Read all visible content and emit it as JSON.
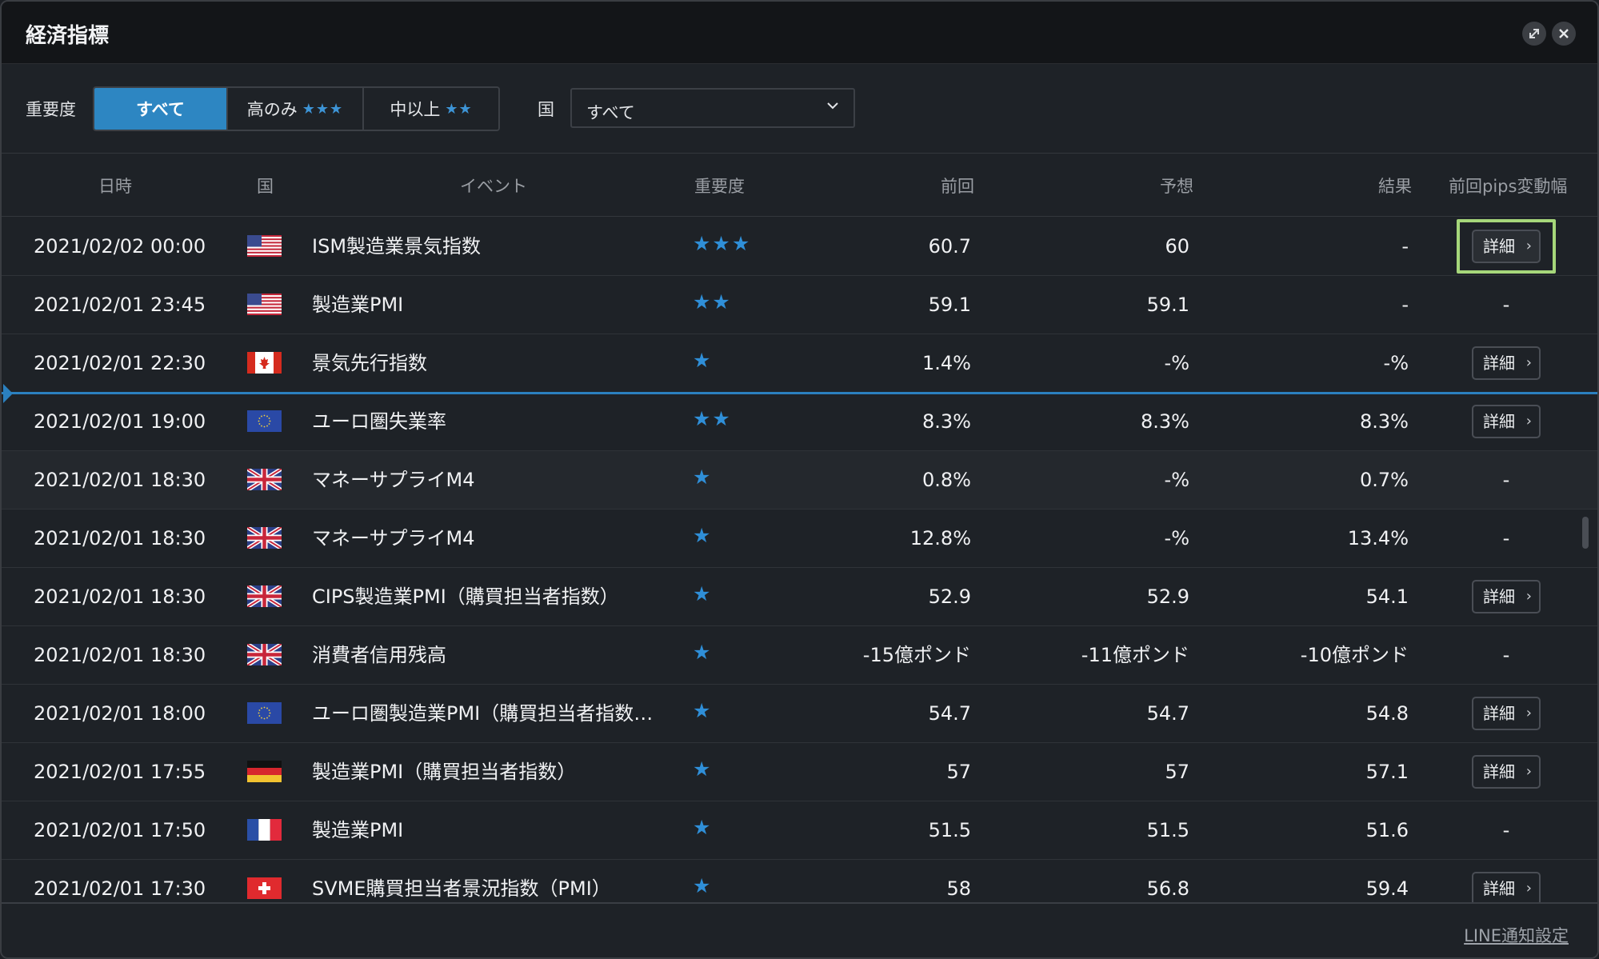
{
  "window": {
    "title": "経済指標",
    "expand_icon": "expand-icon",
    "close_icon": "close-icon"
  },
  "filters": {
    "importance_label": "重要度",
    "importance_options": [
      {
        "label": "すべて",
        "stars": "",
        "active": true
      },
      {
        "label": "高のみ",
        "stars": "★★★",
        "active": false
      },
      {
        "label": "中以上",
        "stars": "★★",
        "active": false
      }
    ],
    "country_label": "国",
    "country_selected": "すべて"
  },
  "table": {
    "headers": {
      "datetime": "日時",
      "country": "国",
      "event": "イベント",
      "importance": "重要度",
      "previous": "前回",
      "forecast": "予想",
      "result": "結果",
      "pips": "前回pips変動幅"
    },
    "detail_label": "詳細",
    "rows": [
      {
        "datetime": "2021/02/02 00:00",
        "flag": "us",
        "event": "ISM製造業景気指数",
        "stars": "★★★",
        "previous": "60.7",
        "forecast": "60",
        "result": "-",
        "pips": "detail",
        "highlight": true
      },
      {
        "datetime": "2021/02/01 23:45",
        "flag": "us",
        "event": "製造業PMI",
        "stars": "★★",
        "previous": "59.1",
        "forecast": "59.1",
        "result": "-",
        "pips": "-"
      },
      {
        "datetime": "2021/02/01 22:30",
        "flag": "ca",
        "event": "景気先行指数",
        "stars": "★",
        "previous": "1.4%",
        "forecast": "-%",
        "result": "-%",
        "pips": "detail"
      },
      {
        "datetime": "2021/02/01 19:00",
        "flag": "eu",
        "event": "ユーロ圏失業率",
        "stars": "★★",
        "previous": "8.3%",
        "forecast": "8.3%",
        "result": "8.3%",
        "pips": "detail"
      },
      {
        "datetime": "2021/02/01 18:30",
        "flag": "gb",
        "event": "マネーサプライM4",
        "stars": "★",
        "previous": "0.8%",
        "forecast": "-%",
        "result": "0.7%",
        "pips": "-",
        "hover": true
      },
      {
        "datetime": "2021/02/01 18:30",
        "flag": "gb",
        "event": "マネーサプライM4",
        "stars": "★",
        "previous": "12.8%",
        "forecast": "-%",
        "result": "13.4%",
        "pips": "-"
      },
      {
        "datetime": "2021/02/01 18:30",
        "flag": "gb",
        "event": "CIPS製造業PMI（購買担当者指数）",
        "stars": "★",
        "previous": "52.9",
        "forecast": "52.9",
        "result": "54.1",
        "pips": "detail"
      },
      {
        "datetime": "2021/02/01 18:30",
        "flag": "gb",
        "event": "消費者信用残高",
        "stars": "★",
        "previous": "-15億ポンド",
        "forecast": "-11億ポンド",
        "result": "-10億ポンド",
        "pips": "-"
      },
      {
        "datetime": "2021/02/01 18:00",
        "flag": "eu",
        "event": "ユーロ圏製造業PMI（購買担当者指数…",
        "stars": "★",
        "previous": "54.7",
        "forecast": "54.7",
        "result": "54.8",
        "pips": "detail"
      },
      {
        "datetime": "2021/02/01 17:55",
        "flag": "de",
        "event": "製造業PMI（購買担当者指数）",
        "stars": "★",
        "previous": "57",
        "forecast": "57",
        "result": "57.1",
        "pips": "detail"
      },
      {
        "datetime": "2021/02/01 17:50",
        "flag": "fr",
        "event": "製造業PMI",
        "stars": "★",
        "previous": "51.5",
        "forecast": "51.5",
        "result": "51.6",
        "pips": "-"
      },
      {
        "datetime": "2021/02/01 17:30",
        "flag": "ch",
        "event": "SVME購買担当者景況指数（PMI）",
        "stars": "★",
        "previous": "58",
        "forecast": "56.8",
        "result": "59.4",
        "pips": "detail"
      }
    ]
  },
  "footer": {
    "line_link": "LINE通知設定"
  },
  "colors": {
    "accent": "#2d86c2",
    "star": "#2f8fd8",
    "highlight": "#a6d77a"
  }
}
